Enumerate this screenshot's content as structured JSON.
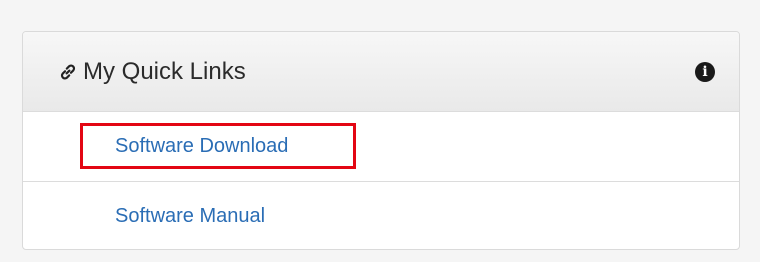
{
  "panel": {
    "title": "My Quick Links",
    "title_icon": "link-icon",
    "info_icon": "info-icon",
    "info_glyph": "i"
  },
  "links": [
    {
      "label": "Software Download",
      "highlighted": true
    },
    {
      "label": "Software Manual",
      "highlighted": false
    }
  ],
  "colors": {
    "link": "#2a6db5",
    "highlight_border": "#e30613",
    "header_bg": "#eeeeee"
  }
}
